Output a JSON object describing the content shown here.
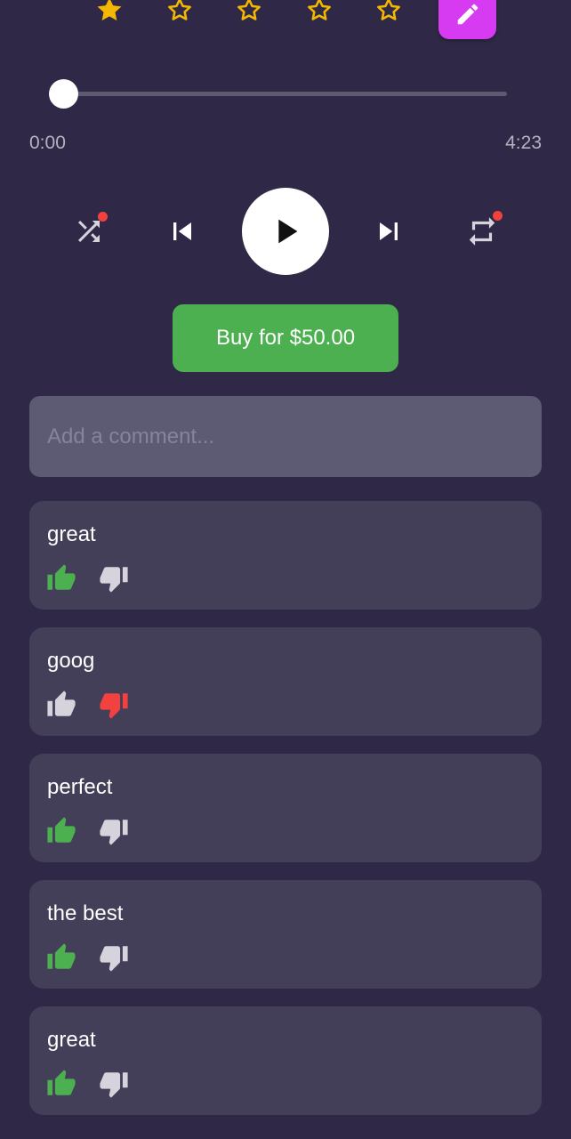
{
  "rating": {
    "stars": [
      {
        "filled": true
      },
      {
        "filled": false
      },
      {
        "filled": false
      },
      {
        "filled": false
      },
      {
        "filled": false
      }
    ],
    "star_color": "#f5b800"
  },
  "edit_button": {
    "icon": "pencil-icon",
    "color": "#d63bf2"
  },
  "player": {
    "progress": 0.0,
    "current_time": "0:00",
    "total_time": "4:23",
    "controls": {
      "shuffle_icon": "shuffle-icon",
      "previous_icon": "skip-previous-icon",
      "play_icon": "play-icon",
      "next_icon": "skip-next-icon",
      "repeat_icon": "repeat-icon",
      "indicator_color": "#f2413f"
    }
  },
  "buy_button": {
    "label": "Buy for $50.00",
    "color": "#4caf50"
  },
  "comment_input": {
    "placeholder": "Add a comment...",
    "value": ""
  },
  "comments": [
    {
      "text": "great",
      "liked": true,
      "disliked": false
    },
    {
      "text": "goog",
      "liked": false,
      "disliked": true
    },
    {
      "text": "perfect",
      "liked": true,
      "disliked": false
    },
    {
      "text": "the best",
      "liked": true,
      "disliked": false
    },
    {
      "text": "great",
      "liked": true,
      "disliked": false
    }
  ],
  "colors": {
    "like_active": "#4caf50",
    "dislike_active": "#f2413f",
    "vote_inactive": "#d6d3dc",
    "background": "#2f2947",
    "card": "#433f58"
  }
}
